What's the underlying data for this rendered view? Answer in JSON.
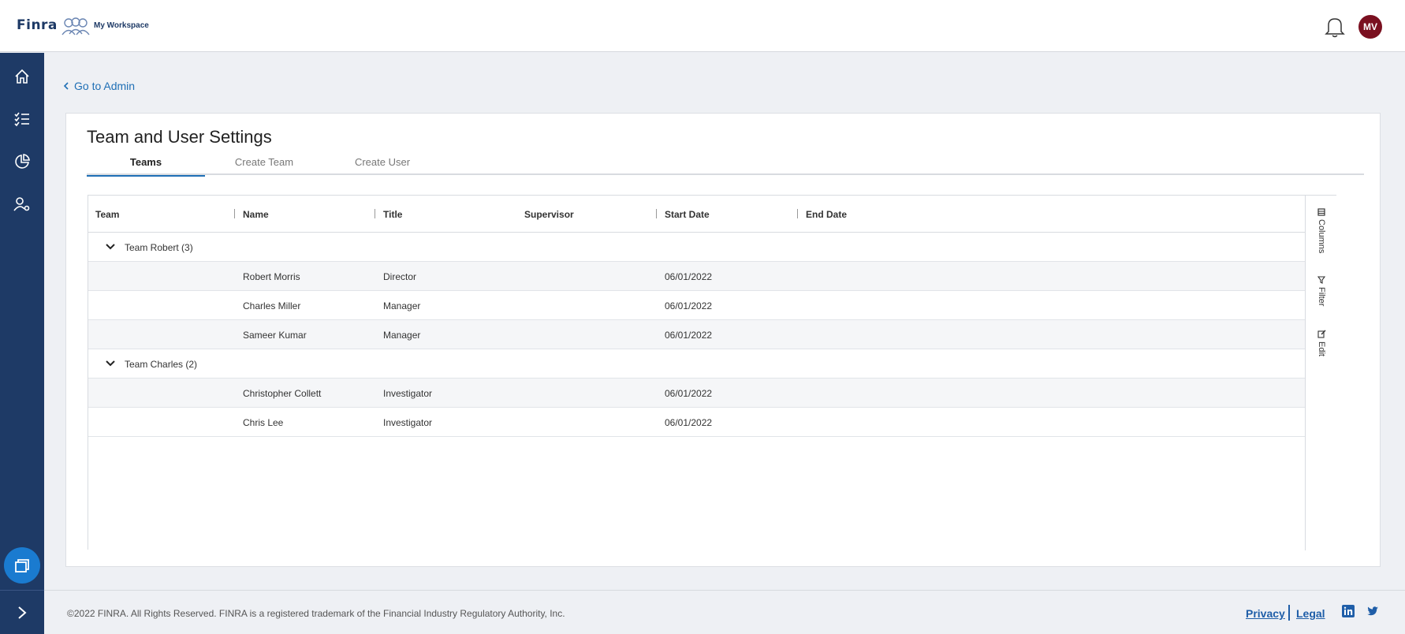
{
  "header": {
    "logo_text": "Finra",
    "workspace_title": "My Workspace",
    "avatar_initials": "MV"
  },
  "back_link": "Go to Admin",
  "page": {
    "title": "Team and User Settings",
    "tabs": [
      {
        "label": "Teams",
        "active": true
      },
      {
        "label": "Create Team",
        "active": false
      },
      {
        "label": "Create User",
        "active": false
      }
    ]
  },
  "grid": {
    "columns": [
      "Team",
      "Name",
      "Title",
      "Supervisor",
      "Start Date",
      "End Date"
    ],
    "groups": [
      {
        "label": "Team Robert (3)",
        "rows": [
          {
            "name": "Robert Morris",
            "title": "Director",
            "supervisor": "",
            "start_date": "06/01/2022",
            "end_date": ""
          },
          {
            "name": "Charles Miller",
            "title": "Manager",
            "supervisor": "",
            "start_date": "06/01/2022",
            "end_date": ""
          },
          {
            "name": "Sameer Kumar",
            "title": "Manager",
            "supervisor": "",
            "start_date": "06/01/2022",
            "end_date": ""
          }
        ]
      },
      {
        "label": "Team Charles (2)",
        "rows": [
          {
            "name": "Christopher Collett",
            "title": "Investigator",
            "supervisor": "",
            "start_date": "06/01/2022",
            "end_date": ""
          },
          {
            "name": "Chris Lee",
            "title": "Investigator",
            "supervisor": "",
            "start_date": "06/01/2022",
            "end_date": ""
          }
        ]
      }
    ],
    "side_panel": [
      "Columns",
      "Filter",
      "Edit"
    ]
  },
  "footer": {
    "copyright": "©2022 FINRA. All Rights Reserved. FINRA is a registered trademark of the Financial Industry Regulatory Authority, Inc.",
    "privacy": "Privacy",
    "legal": "Legal"
  },
  "colors": {
    "nav": "#1e3a66",
    "accent": "#1f6fb5",
    "avatar": "#7a1020"
  }
}
